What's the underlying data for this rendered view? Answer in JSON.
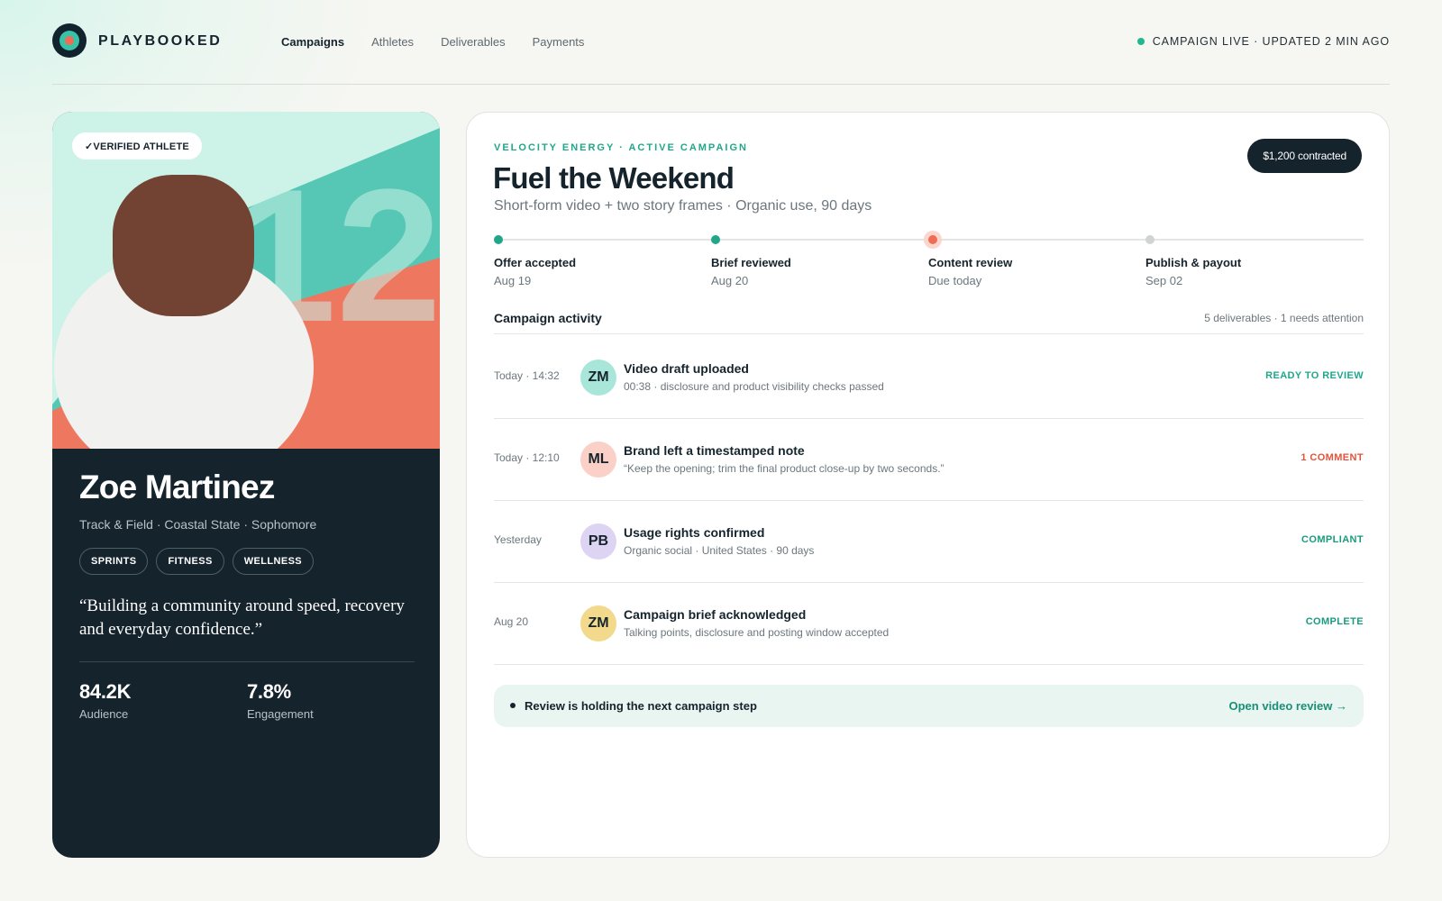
{
  "header": {
    "brand": "PLAYBOOKED",
    "nav": [
      {
        "label": "Campaigns",
        "active": true
      },
      {
        "label": "Athletes",
        "active": false
      },
      {
        "label": "Deliverables",
        "active": false
      },
      {
        "label": "Payments",
        "active": false
      }
    ],
    "status": "CAMPAIGN LIVE · UPDATED 2 MIN AGO"
  },
  "athlete": {
    "badge": "✓VERIFIED ATHLETE",
    "jersey_number": "12",
    "name": "Zoe Martinez",
    "meta": "Track & Field · Coastal State · Sophomore",
    "tags": [
      "SPRINTS",
      "FITNESS",
      "WELLNESS"
    ],
    "quote": "“Building a community around speed, recovery and everyday confidence.”",
    "stats": [
      {
        "value": "84.2K",
        "label": "Audience"
      },
      {
        "value": "7.8%",
        "label": "Engagement"
      }
    ]
  },
  "campaign": {
    "eyebrow": "VELOCITY ENERGY · ACTIVE CAMPAIGN",
    "title": "Fuel the Weekend",
    "subtitle": "Short-form video + two story frames · Organic use, 90 days",
    "contract": "$1,200 contracted",
    "steps": [
      {
        "label": "Offer accepted",
        "date": "Aug 19",
        "state": "done"
      },
      {
        "label": "Brief reviewed",
        "date": "Aug 20",
        "state": "done"
      },
      {
        "label": "Content review",
        "date": "Due today",
        "state": "current"
      },
      {
        "label": "Publish & payout",
        "date": "Sep 02",
        "state": "upcoming"
      }
    ],
    "activity_title": "Campaign activity",
    "activity_summary": "5 deliverables · 1 needs attention",
    "activity": [
      {
        "time": "Today · 14:32",
        "initials": "ZM",
        "title": "Video draft uploaded",
        "desc": "00:38 · disclosure and product visibility checks passed",
        "status": "READY TO REVIEW"
      },
      {
        "time": "Today · 12:10",
        "initials": "ML",
        "title": "Brand left a timestamped note",
        "desc": "“Keep the opening; trim the final product close-up by two seconds.”",
        "status": "1 COMMENT"
      },
      {
        "time": "Yesterday",
        "initials": "PB",
        "title": "Usage rights confirmed",
        "desc": "Organic social · United States · 90 days",
        "status": "COMPLIANT"
      },
      {
        "time": "Aug 20",
        "initials": "ZM",
        "title": "Campaign brief acknowledged",
        "desc": "Talking points, disclosure and posting window accepted",
        "status": "COMPLETE"
      }
    ],
    "notice": "Review is holding the next campaign step",
    "notice_link": "Open video review →"
  },
  "colors": {
    "accent_green": "#20a78a",
    "accent_coral": "#ef6d55",
    "dark": "#15232c",
    "avatar_teal": "#a9e6da",
    "avatar_pink": "#fbd0c6",
    "avatar_lavender": "#ddd3f3",
    "avatar_yellow": "#f3d98c"
  }
}
